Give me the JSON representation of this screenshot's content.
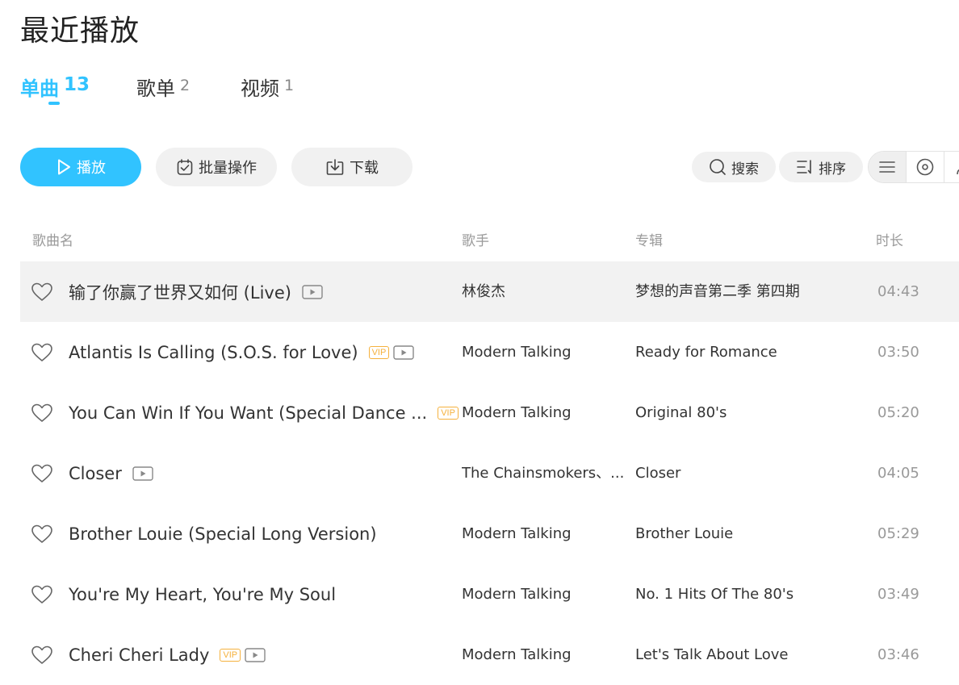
{
  "page": {
    "title": "最近播放"
  },
  "tabs": [
    {
      "label": "单曲",
      "count": "13",
      "active": true
    },
    {
      "label": "歌单",
      "count": "2",
      "active": false
    },
    {
      "label": "视频",
      "count": "1",
      "active": false
    }
  ],
  "toolbar": {
    "play_label": "播放",
    "batch_label": "批量操作",
    "download_label": "下载",
    "search_label": "搜索",
    "sort_label": "排序"
  },
  "table": {
    "headers": {
      "name": "歌曲名",
      "artist": "歌手",
      "album": "专辑",
      "duration": "时长"
    },
    "rows": [
      {
        "name": "输了你赢了世界又如何 (Live)",
        "vip": false,
        "mv": true,
        "artist": "林俊杰",
        "album": "梦想的声音第二季 第四期",
        "duration": "04:43"
      },
      {
        "name": "Atlantis Is Calling (S.O.S. for Love)",
        "vip": true,
        "mv": true,
        "artist": "Modern Talking",
        "album": "Ready for Romance",
        "duration": "03:50"
      },
      {
        "name": "You Can Win If You Want (Special Dance ...",
        "vip": true,
        "mv": false,
        "artist": "Modern Talking",
        "album": "Original 80's",
        "duration": "05:20"
      },
      {
        "name": "Closer",
        "vip": false,
        "mv": true,
        "artist": "The Chainsmokers、...",
        "album": "Closer",
        "duration": "04:05"
      },
      {
        "name": "Brother Louie (Special Long Version)",
        "vip": false,
        "mv": false,
        "artist": "Modern Talking",
        "album": "Brother Louie",
        "duration": "05:29"
      },
      {
        "name": "You're My Heart, You're My Soul",
        "vip": false,
        "mv": false,
        "artist": "Modern Talking",
        "album": "No. 1 Hits Of  The 80's",
        "duration": "03:49"
      },
      {
        "name": "Cheri Cheri Lady",
        "vip": true,
        "mv": true,
        "artist": "Modern Talking",
        "album": "Let's Talk About Love",
        "duration": "03:46"
      }
    ],
    "vip_badge": "VIP"
  },
  "colors": {
    "accent": "#31c3ff",
    "vip": "#f5b13d",
    "row_highlight": "#f2f2f2",
    "button_bg": "#f1f1f1"
  },
  "icons": {
    "play": "play-icon",
    "batch": "checkbox-icon",
    "download": "download-icon",
    "search": "search-icon",
    "sort": "sort-icon",
    "list_view": "list-icon",
    "album_view": "disc-icon",
    "artist_view": "user-icon",
    "favorite": "heart-icon",
    "mv": "video-icon"
  }
}
